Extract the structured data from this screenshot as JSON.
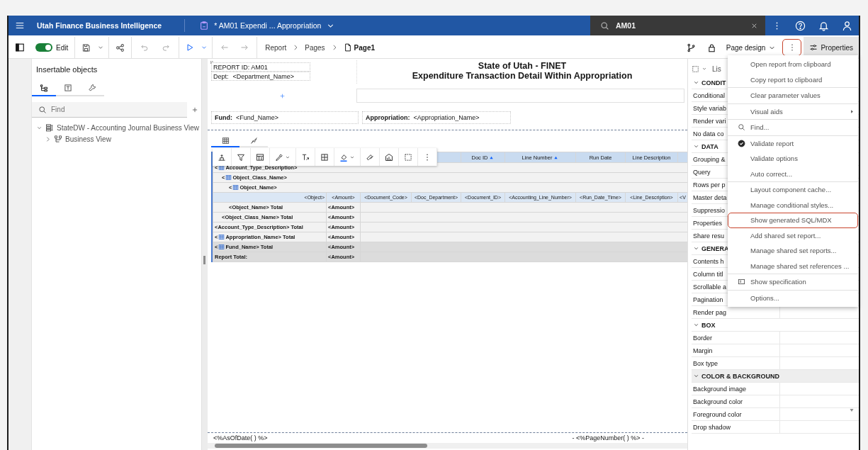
{
  "top_bar": {
    "app_title": "Utah Finance Business Intelligence",
    "document_tab": "* AM01 Expendi ... Appropriation",
    "search": {
      "value": "AM01"
    }
  },
  "toolbar": {
    "edit_toggle": {
      "label": "Edit",
      "on": true
    },
    "breadcrumb": [
      {
        "label": "Report",
        "current": false
      },
      {
        "label": "Pages",
        "current": false
      },
      {
        "label": "Page1",
        "current": true
      }
    ],
    "view_menu": "Page design",
    "more_button": {
      "highlighted": true
    },
    "properties_button": {
      "label": "Properties",
      "selected": true
    }
  },
  "insertable_objects": {
    "title": "Insertable objects",
    "tabs": [
      {
        "selected": true
      },
      {
        "selected": false
      },
      {
        "selected": false
      }
    ],
    "search": {
      "placeholder": "Find"
    },
    "tree": [
      {
        "label": "StateDW - Accounting Journal Business View",
        "expanded": true,
        "children": [
          {
            "label": "Business View",
            "expanded": false
          }
        ]
      }
    ]
  },
  "report": {
    "header": {
      "report_id": "REPORT ID: AM01",
      "dept_label": "Dept:",
      "dept_value": "<Department_Name>",
      "title": "State of Utah - FINET",
      "subtitle": "Expenditure Transaction Detail Within Appropriation",
      "fund_label": "Fund:",
      "fund_value": "<Fund_Name>",
      "appropriation_label": "Appropriation:",
      "appropriation_value": "<Appropriation_Name>"
    },
    "list_tabs": [
      {
        "selected": true
      },
      {
        "selected": false
      }
    ],
    "column_headers": [
      {
        "label": "Doc ID",
        "sorted": true
      },
      {
        "label": "Line Number",
        "sorted": true
      },
      {
        "label": "Run Date",
        "sorted": false
      },
      {
        "label": "Line Description",
        "sorted": false
      }
    ],
    "rows": [
      {
        "kind": "group_header",
        "open": "<",
        "label": "Account_Type_Description>",
        "selected": false,
        "shaded": false
      },
      {
        "kind": "group_header",
        "open": "<",
        "label": "Object_Class_Name>",
        "selected": false,
        "shaded": false
      },
      {
        "kind": "group_header",
        "open": "<",
        "label": "Object_Name>",
        "selected": false,
        "shaded": false
      },
      {
        "kind": "detail",
        "cells": [
          "<Object>",
          "<Amount>",
          "<Document_Code>",
          "<Doc_Department>",
          "<Document_ID>",
          "<Accounting_Line_Number>",
          "<Run_Date_Time>",
          "<Line_Description>",
          "<V"
        ],
        "selected": true,
        "shaded": false
      },
      {
        "kind": "group_footer",
        "label": "<Object_Name>  Total",
        "amount": "<Amount>",
        "selected": false,
        "shaded": false
      },
      {
        "kind": "group_footer",
        "label": "<Object_Class_Name>  Total",
        "amount": "<Amount>",
        "selected": false,
        "shaded": false
      },
      {
        "kind": "group_footer",
        "label": "<Account_Type_Description>  Total",
        "amount": "<Amount>",
        "selected": false,
        "shaded": false
      },
      {
        "kind": "group_footer",
        "open": "<",
        "label": "Appropriation_Name>  Total",
        "amount": "<Amount>",
        "selected": false,
        "shaded": false
      },
      {
        "kind": "group_footer",
        "open": "<",
        "label": "Fund_Name>  Total",
        "amount": "<Amount>",
        "selected": false,
        "shaded": true
      },
      {
        "kind": "report_footer",
        "label": "Report Total:",
        "amount": "<Amount>",
        "selected": false,
        "shaded": true
      }
    ],
    "footer": {
      "left": "<%AsOfDate( ) %>",
      "right": "-  <%PageNumber( ) %>  -"
    }
  },
  "properties": {
    "object_type": "Lis",
    "sections": [
      {
        "title": "CONDIT",
        "expanded": true,
        "selected": false,
        "items": [
          "Conditional",
          "Style variab",
          "Render vari",
          "No data co"
        ]
      },
      {
        "title": "DATA",
        "expanded": true,
        "selected": false,
        "items": [
          "Grouping &",
          "Query",
          "Rows per p",
          "Master deta",
          "Suppressio",
          "Properties",
          "Share resu"
        ]
      },
      {
        "title": "GENERA",
        "expanded": true,
        "selected": false,
        "items": [
          "Contents h",
          "Column titl",
          "Scrollable a",
          "Pagination",
          "Render pag"
        ]
      },
      {
        "title": "BOX",
        "expanded": true,
        "selected": false,
        "items": [
          "Border",
          "Margin",
          "Box type"
        ]
      },
      {
        "title": "COLOR & BACKGROUND",
        "expanded": true,
        "selected": true,
        "items": [
          "Background image",
          "Background color",
          "Foreground color",
          "Drop shadow"
        ]
      }
    ]
  },
  "menu": {
    "groups": [
      [
        {
          "label": "Open report from clipboard",
          "kind": "plain",
          "highlighted": false
        },
        {
          "label": "Copy report to clipboard",
          "kind": "plain",
          "highlighted": false
        }
      ],
      [
        {
          "label": "Clear parameter values",
          "kind": "plain",
          "highlighted": false
        }
      ],
      [
        {
          "label": "Visual aids",
          "kind": "submenu",
          "highlighted": false
        }
      ],
      [
        {
          "label": "Find...",
          "kind": "search",
          "highlighted": false
        }
      ],
      [
        {
          "label": "Validate report",
          "kind": "check",
          "highlighted": false
        },
        {
          "label": "Validate options",
          "kind": "plain",
          "highlighted": false
        },
        {
          "label": "Auto correct...",
          "kind": "plain",
          "highlighted": false
        }
      ],
      [
        {
          "label": "Layout component cache...",
          "kind": "plain",
          "highlighted": false
        },
        {
          "label": "Manage conditional styles...",
          "kind": "plain",
          "highlighted": false
        },
        {
          "label": "Show generated SQL/MDX",
          "kind": "plain",
          "highlighted": true
        },
        {
          "label": "Add shared set report...",
          "kind": "plain",
          "highlighted": false
        },
        {
          "label": "Manage shared set reports...",
          "kind": "plain",
          "highlighted": false
        },
        {
          "label": "Manage shared set references ...",
          "kind": "plain",
          "highlighted": false
        }
      ],
      [
        {
          "label": "Show specification",
          "kind": "spec",
          "highlighted": false
        }
      ],
      [
        {
          "label": "Options...",
          "kind": "plain",
          "highlighted": false
        }
      ]
    ]
  }
}
